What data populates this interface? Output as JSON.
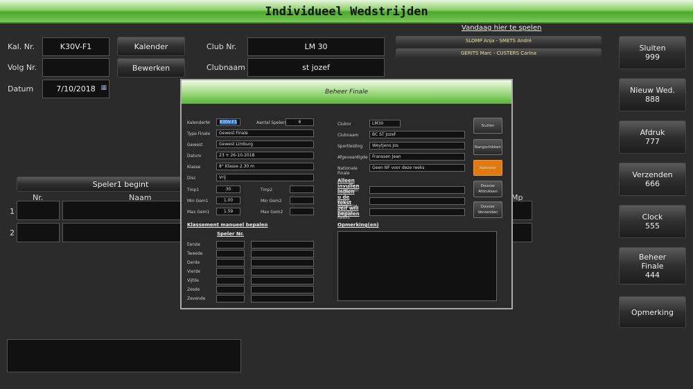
{
  "window": {
    "title": "Individueel Wedstrijden"
  },
  "form": {
    "kal_nr_label": "Kal. Nr.",
    "kal_nr": "K30V-F1",
    "volg_nr_label": "Volg Nr.",
    "volg_nr": "",
    "datum_label": "Datum",
    "datum": "7/10/2018",
    "club_nr_label": "Club Nr.",
    "club_nr": "LM 30",
    "clubnaam_label": "Clubnaam",
    "clubnaam": "st jozef",
    "kalender_btn": "Kalender",
    "bewerken_btn": "Bewerken"
  },
  "today": {
    "title": "Vandaag hier te spelen",
    "matches": [
      "SLOMP  Anja - SMETS André",
      "GERITS  Marc - CUSTERS Carina"
    ]
  },
  "side_buttons": [
    {
      "label": "Sluiten",
      "code": "999"
    },
    {
      "label": "Nieuw Wed.",
      "code": "888"
    },
    {
      "label": "Afdruk",
      "code": "777"
    },
    {
      "label": "Verzenden",
      "code": "666"
    },
    {
      "label": "Clock",
      "code": "555"
    },
    {
      "label": "Beheer Finale",
      "code": "444"
    },
    {
      "label": "Opmerking",
      "code": ""
    }
  ],
  "players": {
    "starter": "Speler1 begint",
    "col_nr": "Nr.",
    "col_naam": "Naam",
    "col_mp": "Mp",
    "rows": [
      "1",
      "2"
    ]
  },
  "dialog": {
    "title": "Beheer Finale",
    "kalendernr_label": "KalenderNr",
    "kalendernr": "K30V-F1",
    "aantal_label": "Aantal Spelers",
    "aantal": "6",
    "type_label": "Type Finale",
    "type": "Gewest Finale",
    "gewest_label": "Gewest",
    "gewest": "Gewest Limburg",
    "datum_label": "Datum",
    "datum": "23 + 26-10-2018",
    "klasse_label": "Klasse",
    "klasse": "8° Klasse 2.30 m",
    "disc_label": "Disc",
    "disc": "Vrij",
    "tmp1_label": "Tmp1",
    "tmp1": "30",
    "tmp2_label": "Tmp2",
    "tmp2": "",
    "mingem1_label": "Min Gem1",
    "mingem1": "1.00",
    "mingem2_label": "Min Gem2",
    "mingem2": "",
    "maxgem1_label": "Max Gem1",
    "maxgem1": "1.59",
    "maxgem2_label": "Max Gem2",
    "maxgem2": "",
    "klassement_title": "Klassement manueel bepalen",
    "speler_nr_header": "Speler Nr.",
    "ranks": [
      "Eerste",
      "Tweede",
      "Derde",
      "Vierde",
      "Vijfde",
      "Zesde",
      "Zevende"
    ],
    "clubnr_label": "Clubnr",
    "clubnr": "LM30",
    "clubnaam_label": "Clubnaam",
    "clubnaam": "BC ST Jozef",
    "sportleiding_label": "Sportleiding",
    "sportleiding": "Weytjens Jos",
    "afgevaardigde_label": "Afgevaardigde",
    "afgevaardigde": "Franssen Jean",
    "natfinale_label": "Nationale Finale",
    "natfinale": "Geen NF voor deze reeks",
    "custom_title": "Alleen invullen indien u de tekst zelf will bepalen",
    "kampioen_label": "Kampioen",
    "beste_label": "Beste Wedstrijd",
    "hooste_label": "Hooste Reeks",
    "opmerking_label": "Opmerking(en)",
    "buttons": {
      "sluiten": "Sluiten",
      "rangschikken": "Rangschikken",
      "kalender": "Kalender",
      "dossier_afdrukken": [
        "Dossier",
        "Afdrukken"
      ],
      "dossier_verzenden": [
        "Dossier",
        "Verzenden"
      ]
    }
  },
  "colors": {
    "accent_green": "#58b438",
    "orange": "#e07a10"
  }
}
